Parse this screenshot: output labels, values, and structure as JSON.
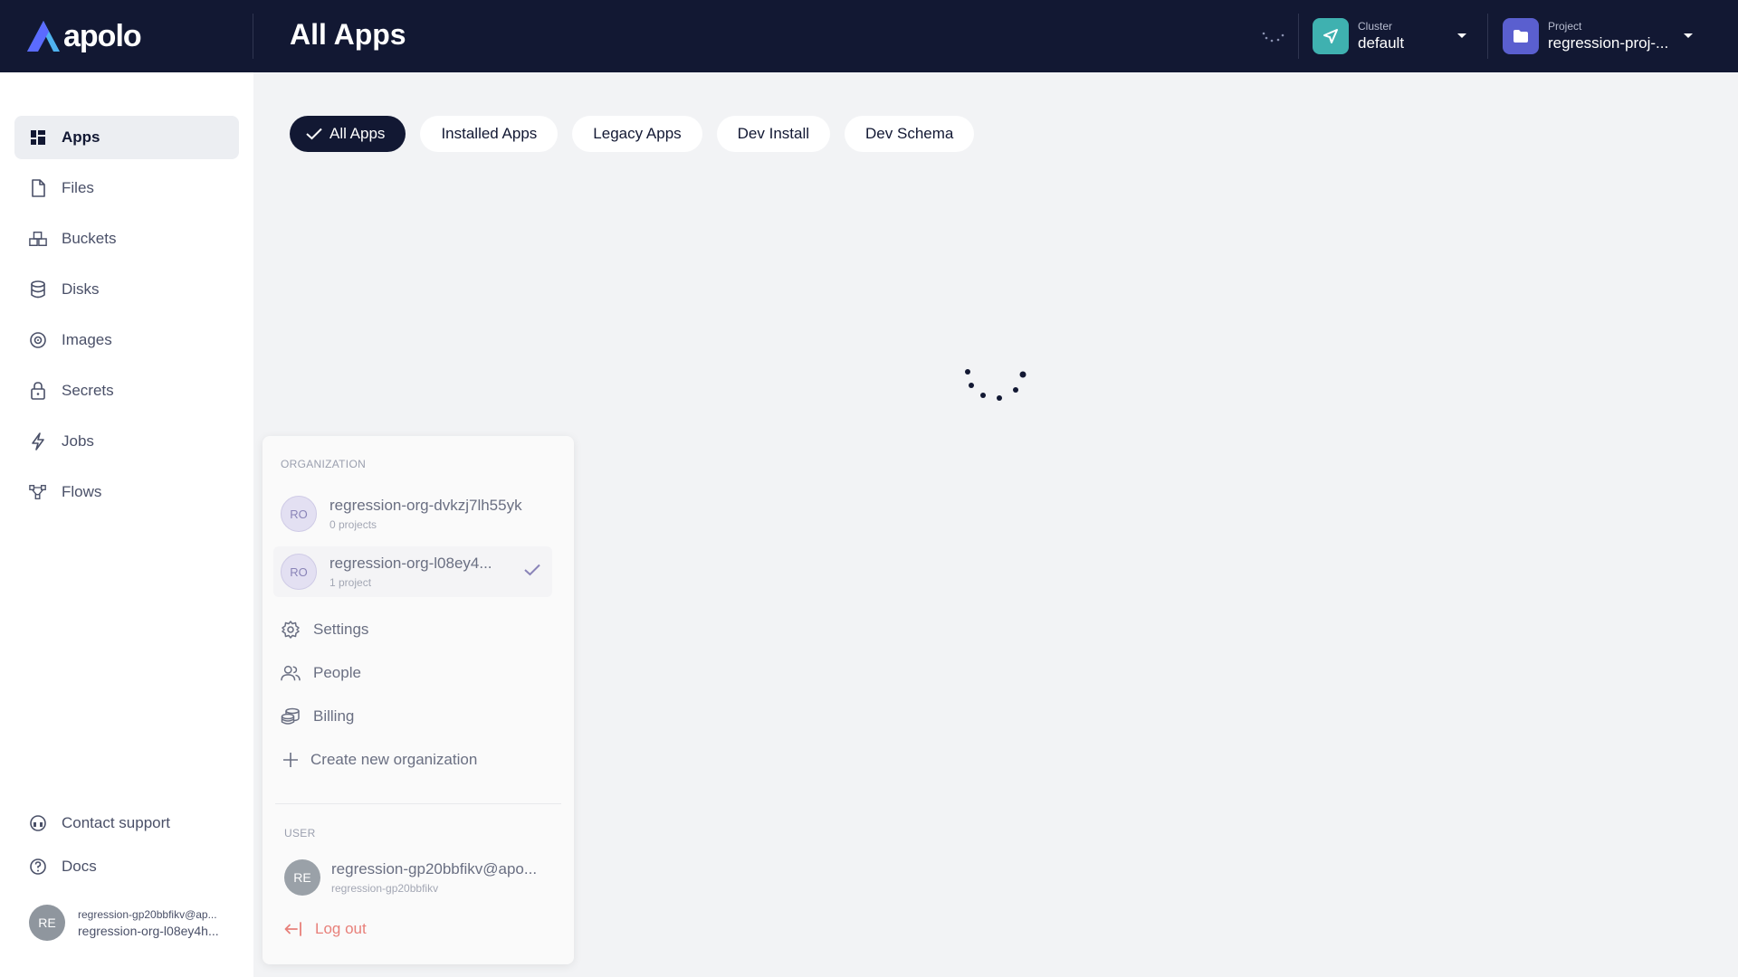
{
  "header": {
    "logo_text": "apolo",
    "page_title": "All Apps",
    "cluster": {
      "label": "Cluster",
      "value": "default",
      "color": "#3fb1b0"
    },
    "project": {
      "label": "Project",
      "value": "regression-proj-...",
      "color": "#5a5fcf"
    }
  },
  "sidebar": {
    "items": [
      {
        "label": "Apps",
        "icon": "apps-grid-icon",
        "active": true
      },
      {
        "label": "Files",
        "icon": "file-icon"
      },
      {
        "label": "Buckets",
        "icon": "buckets-icon"
      },
      {
        "label": "Disks",
        "icon": "database-icon"
      },
      {
        "label": "Images",
        "icon": "image-disc-icon"
      },
      {
        "label": "Secrets",
        "icon": "lock-icon"
      },
      {
        "label": "Jobs",
        "icon": "lightning-icon"
      },
      {
        "label": "Flows",
        "icon": "flows-icon"
      }
    ],
    "footer": {
      "contact_support": "Contact support",
      "docs": "Docs",
      "user_initials": "RE",
      "user_email": "regression-gp20bbfikv@ap...",
      "user_org": "regression-org-l08ey4h..."
    }
  },
  "tabs": [
    {
      "label": "All Apps",
      "active": true
    },
    {
      "label": "Installed Apps"
    },
    {
      "label": "Legacy Apps"
    },
    {
      "label": "Dev Install"
    },
    {
      "label": "Dev Schema"
    }
  ],
  "org_dropdown": {
    "organization_label": "ORGANIZATION",
    "orgs": [
      {
        "initials": "RO",
        "name": "regression-org-dvkzj7lh55yk",
        "sub": "0 projects",
        "selected": false
      },
      {
        "initials": "RO",
        "name": "regression-org-l08ey4...",
        "sub": "1 project",
        "selected": true
      }
    ],
    "menu": {
      "settings": "Settings",
      "people": "People",
      "billing": "Billing",
      "create": "Create new organization"
    },
    "user_label": "USER",
    "user": {
      "initials": "RE",
      "email": "regression-gp20bbfikv@apo...",
      "username": "regression-gp20bbfikv"
    },
    "logout": "Log out"
  }
}
